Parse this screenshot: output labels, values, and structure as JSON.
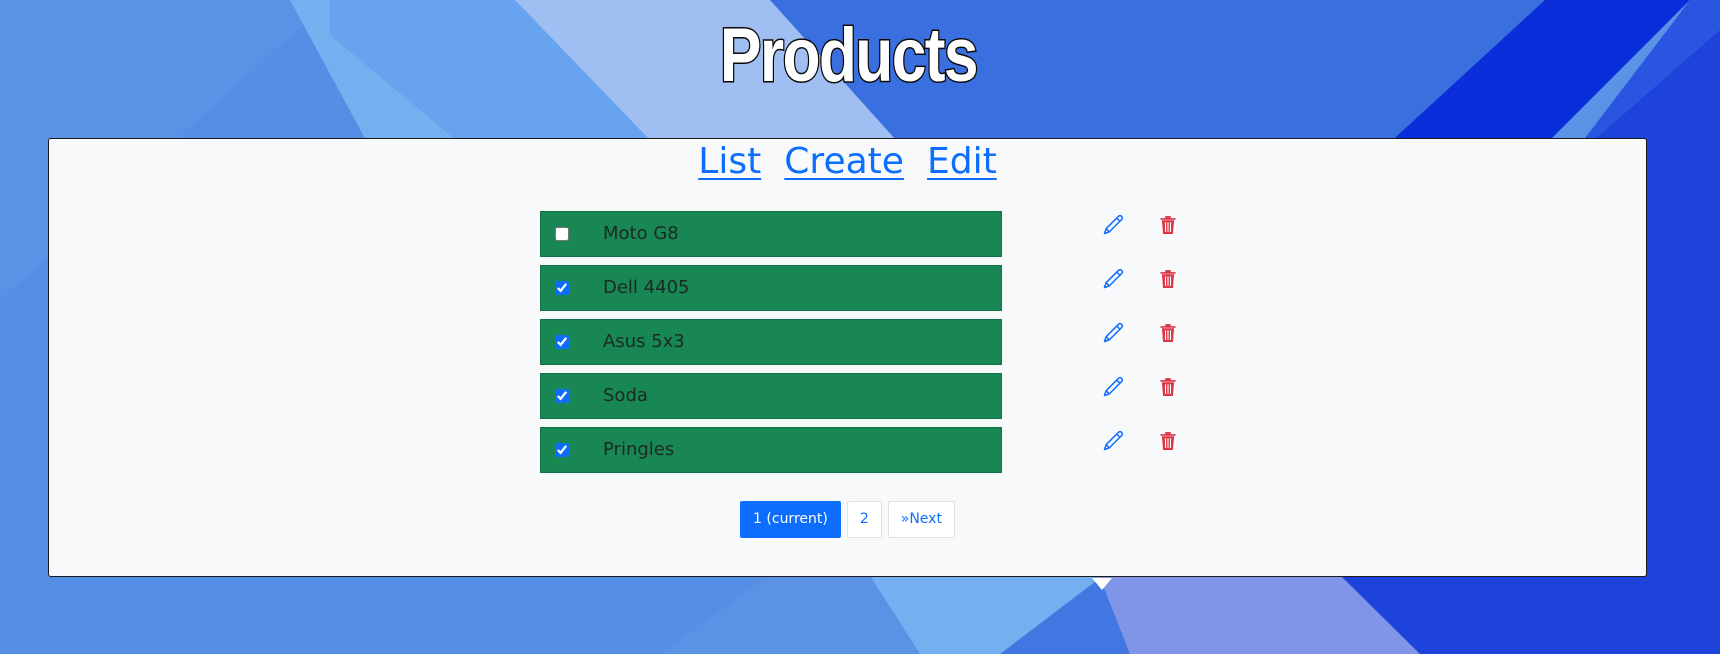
{
  "header": {
    "title": "Products"
  },
  "nav": {
    "list": "List",
    "create": "Create",
    "edit": "Edit"
  },
  "products": [
    {
      "name": "Moto G8",
      "checked": false
    },
    {
      "name": "Dell 4405",
      "checked": true
    },
    {
      "name": "Asus 5x3",
      "checked": true
    },
    {
      "name": "Soda",
      "checked": true
    },
    {
      "name": "Pringles",
      "checked": true
    }
  ],
  "pagination": {
    "current": "1 (current)",
    "page2": "2",
    "next": "»Next"
  },
  "icons": {
    "edit": "pencil-icon",
    "delete": "trash-icon"
  },
  "colors": {
    "item_bg": "#198754",
    "link": "#0d6efd",
    "delete": "#dc3545",
    "panel": "#f8f9fa"
  }
}
